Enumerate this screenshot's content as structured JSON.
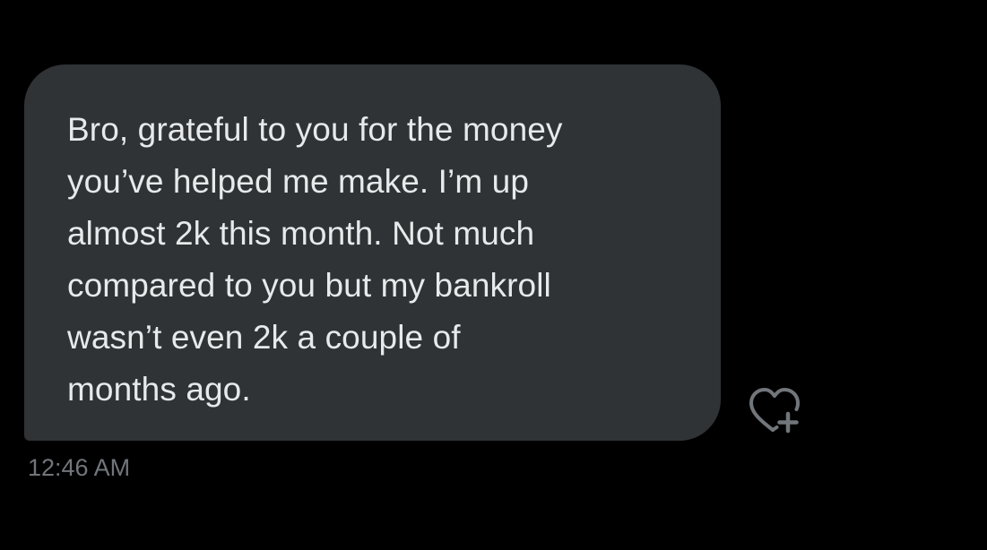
{
  "message": {
    "text": "Bro, grateful to you for the money\nyou’ve helped me make. I’m up\nalmost 2k this month. Not much\ncompared to you but my bankroll\nwasn’t even 2k a couple of\nmonths ago.",
    "timestamp": "12:46 AM"
  },
  "actions": {
    "react_icon": "heart-plus-icon"
  },
  "colors": {
    "background": "#000000",
    "bubble": "#2f3336",
    "text": "#e7e9ea",
    "muted": "#71767b"
  }
}
